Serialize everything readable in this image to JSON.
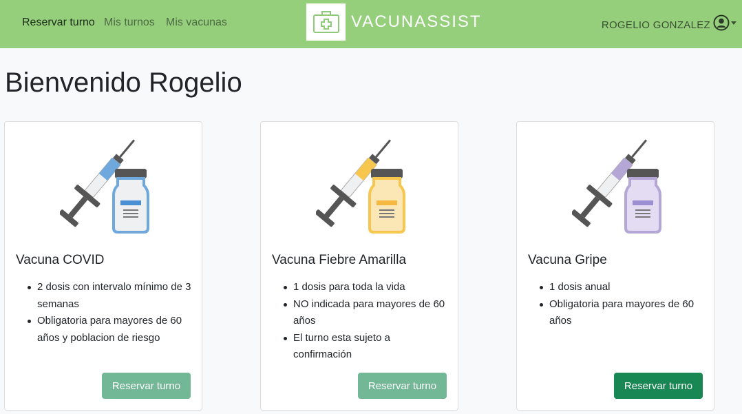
{
  "nav": {
    "links": [
      {
        "label": "Reservar turno",
        "active": true
      },
      {
        "label": "Mis turnos",
        "active": false
      },
      {
        "label": "Mis vacunas",
        "active": false
      }
    ],
    "brand": "VACUNASSIST",
    "user_name": "ROGELIO GONZALEZ",
    "icons": {
      "logo": "medical-kit-icon",
      "user": "user-circle-icon",
      "menu": "caret-down-icon"
    }
  },
  "page": {
    "title": "Bienvenido Rogelio"
  },
  "cards": [
    {
      "title": "Vacuna COVID",
      "color": "#6fa8dc",
      "label_color": "#4a8fd4",
      "items": [
        "2 dosis con intervalo mínimo de 3 semanas",
        "Obligatoria para mayores de 60 años y poblacion de riesgo"
      ],
      "button": "Reservar turno",
      "button_enabled": false
    },
    {
      "title": "Vacuna Fiebre Amarilla",
      "color": "#f6c64e",
      "label_color": "#f4b942",
      "items": [
        "1 dosis para toda la vida",
        "NO indicada para mayores de 60 años",
        "El turno esta sujeto a confirmación"
      ],
      "button": "Reservar turno",
      "button_enabled": false
    },
    {
      "title": "Vacuna Gripe",
      "color": "#b4a7d6",
      "label_color": "#9b8ed1",
      "items": [
        "1 dosis anual",
        "Obligatoria para mayores de 60 años"
      ],
      "button": "Reservar turno",
      "button_enabled": true
    }
  ],
  "colors": {
    "navbar": "#95cf7c",
    "button_disabled": "#72b796",
    "button_enabled": "#198754"
  }
}
